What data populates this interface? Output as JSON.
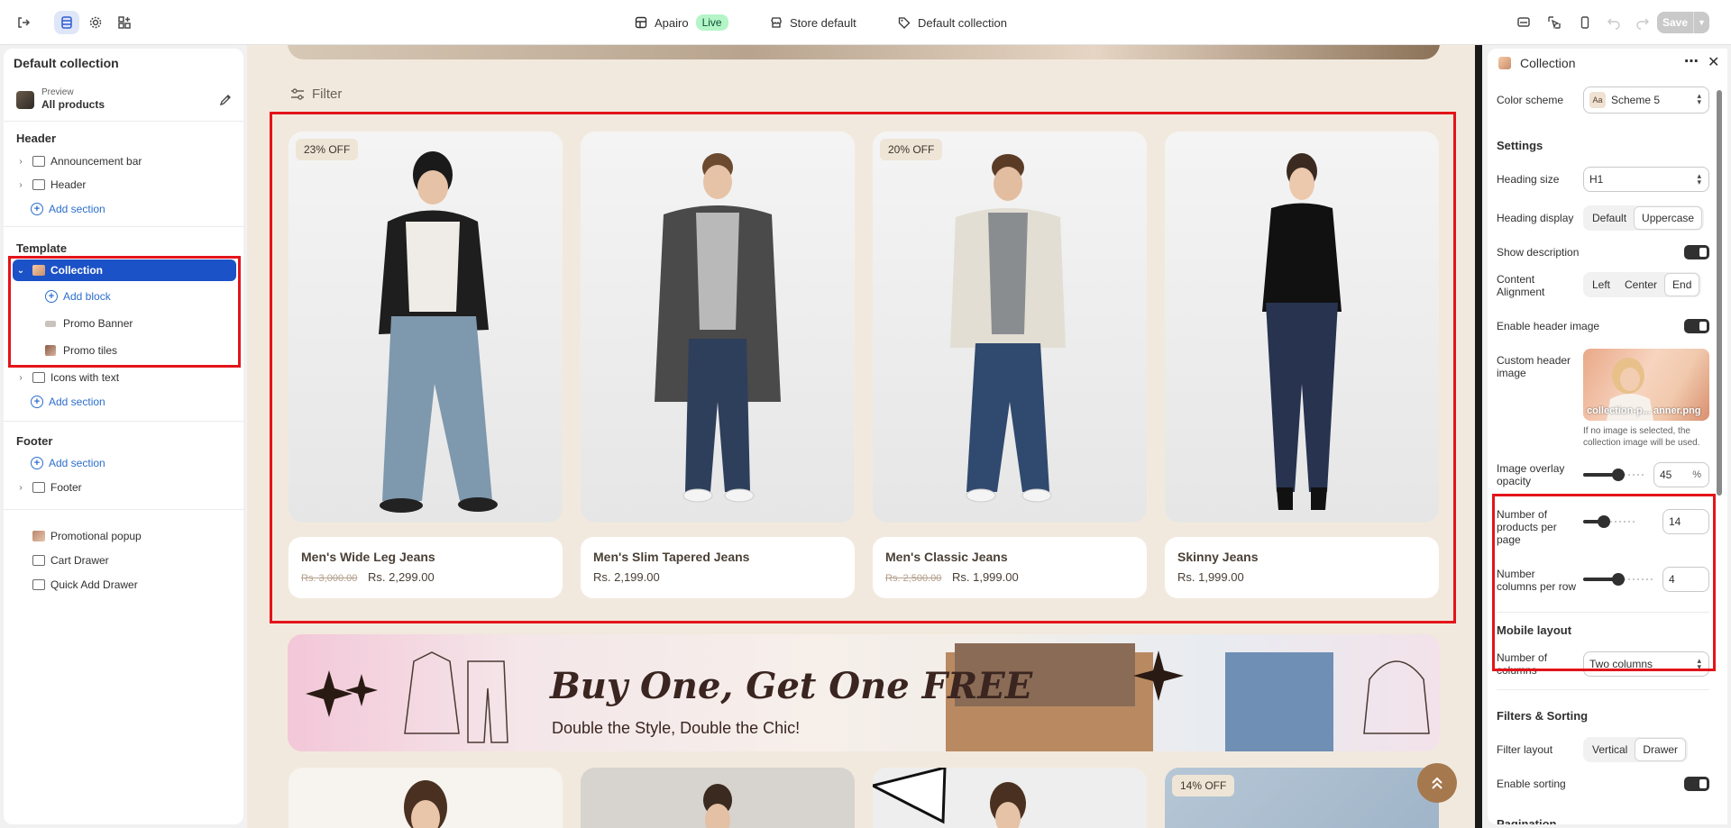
{
  "topbar": {
    "store_name": "Apairo",
    "live_badge": "Live",
    "store_default": "Store default",
    "template": "Default collection",
    "save_label": "Save"
  },
  "left": {
    "title": "Default collection",
    "preview_label": "Preview",
    "preview_value": "All products",
    "groups": {
      "header": "Header",
      "template": "Template",
      "footer": "Footer"
    },
    "header_items": [
      "Announcement bar",
      "Header"
    ],
    "template_items": {
      "collection": "Collection",
      "add_block": "Add block",
      "promo_banner": "Promo Banner",
      "promo_tiles": "Promo tiles",
      "icons_with_text": "Icons with text"
    },
    "footer_item": "Footer",
    "add_section": "Add section",
    "extras": [
      "Promotional popup",
      "Cart Drawer",
      "Quick Add Drawer"
    ]
  },
  "canvas": {
    "filter_label": "Filter",
    "products": [
      {
        "badge": "23% OFF",
        "name": "Men's Wide Leg Jeans",
        "old_price": "Rs. 3,000.00",
        "price": "Rs. 2,299.00"
      },
      {
        "badge": "",
        "name": "Men's Slim Tapered Jeans",
        "old_price": "",
        "price": "Rs. 2,199.00"
      },
      {
        "badge": "20% OFF",
        "name": "Men's Classic Jeans",
        "old_price": "Rs. 2,500.00",
        "price": "Rs. 1,999.00"
      },
      {
        "badge": "",
        "name": "Skinny Jeans",
        "old_price": "",
        "price": "Rs. 1,999.00"
      }
    ],
    "banner_title": "Buy One, Get One FREE",
    "banner_subtitle": "Double the Style, Double the Chic!",
    "row2_badge": "14% OFF"
  },
  "right": {
    "title": "Collection",
    "color_scheme_label": "Color scheme",
    "color_scheme_value": "Scheme 5",
    "color_scheme_swatch": "Aa",
    "settings_heading": "Settings",
    "heading_size_label": "Heading size",
    "heading_size_value": "H1",
    "heading_display_label": "Heading display",
    "heading_display_options": [
      "Default",
      "Uppercase"
    ],
    "show_description_label": "Show description",
    "content_alignment_label": "Content Alignment",
    "content_alignment_options": [
      "Left",
      "Center",
      "End"
    ],
    "enable_header_image_label": "Enable header image",
    "custom_header_image_label": "Custom header image",
    "custom_header_image_file": "collection-p... anner.png",
    "custom_header_help": "If no image is selected, the collection image will be used.",
    "overlay_opacity_label": "Image overlay opacity",
    "overlay_opacity_value": "45",
    "overlay_opacity_unit": "%",
    "products_per_page_label": "Number of products per page",
    "products_per_page_value": "14",
    "columns_per_row_label": "Number columns per row",
    "columns_per_row_value": "4",
    "mobile_layout_heading": "Mobile layout",
    "mobile_columns_label": "Number of columns",
    "mobile_columns_value": "Two columns",
    "filters_sorting_heading": "Filters & Sorting",
    "filter_layout_label": "Filter layout",
    "filter_layout_options": [
      "Vertical",
      "Drawer"
    ],
    "enable_sorting_label": "Enable sorting",
    "pagination_heading": "Pagination"
  },
  "colors": {
    "accent": "#1c52c7",
    "highlight": "#e3141a",
    "canvas_bg": "#f2e9de"
  }
}
